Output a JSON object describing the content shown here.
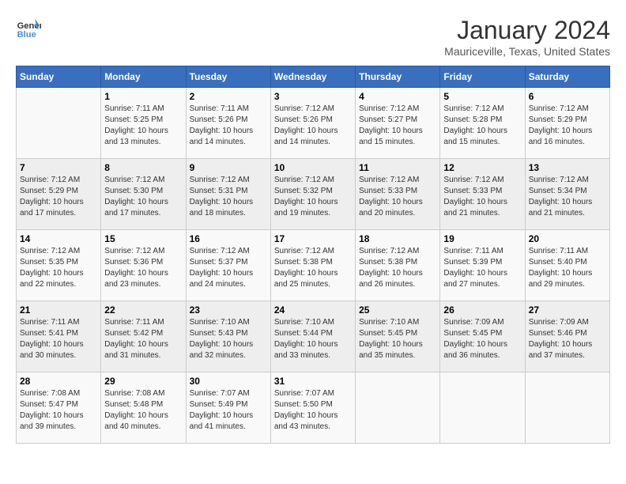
{
  "header": {
    "logo_line1": "General",
    "logo_line2": "Blue",
    "month": "January 2024",
    "location": "Mauriceville, Texas, United States"
  },
  "weekdays": [
    "Sunday",
    "Monday",
    "Tuesday",
    "Wednesday",
    "Thursday",
    "Friday",
    "Saturday"
  ],
  "weeks": [
    [
      {
        "day": "",
        "info": ""
      },
      {
        "day": "1",
        "info": "Sunrise: 7:11 AM\nSunset: 5:25 PM\nDaylight: 10 hours\nand 13 minutes."
      },
      {
        "day": "2",
        "info": "Sunrise: 7:11 AM\nSunset: 5:26 PM\nDaylight: 10 hours\nand 14 minutes."
      },
      {
        "day": "3",
        "info": "Sunrise: 7:12 AM\nSunset: 5:26 PM\nDaylight: 10 hours\nand 14 minutes."
      },
      {
        "day": "4",
        "info": "Sunrise: 7:12 AM\nSunset: 5:27 PM\nDaylight: 10 hours\nand 15 minutes."
      },
      {
        "day": "5",
        "info": "Sunrise: 7:12 AM\nSunset: 5:28 PM\nDaylight: 10 hours\nand 15 minutes."
      },
      {
        "day": "6",
        "info": "Sunrise: 7:12 AM\nSunset: 5:29 PM\nDaylight: 10 hours\nand 16 minutes."
      }
    ],
    [
      {
        "day": "7",
        "info": "Sunrise: 7:12 AM\nSunset: 5:29 PM\nDaylight: 10 hours\nand 17 minutes."
      },
      {
        "day": "8",
        "info": "Sunrise: 7:12 AM\nSunset: 5:30 PM\nDaylight: 10 hours\nand 17 minutes."
      },
      {
        "day": "9",
        "info": "Sunrise: 7:12 AM\nSunset: 5:31 PM\nDaylight: 10 hours\nand 18 minutes."
      },
      {
        "day": "10",
        "info": "Sunrise: 7:12 AM\nSunset: 5:32 PM\nDaylight: 10 hours\nand 19 minutes."
      },
      {
        "day": "11",
        "info": "Sunrise: 7:12 AM\nSunset: 5:33 PM\nDaylight: 10 hours\nand 20 minutes."
      },
      {
        "day": "12",
        "info": "Sunrise: 7:12 AM\nSunset: 5:33 PM\nDaylight: 10 hours\nand 21 minutes."
      },
      {
        "day": "13",
        "info": "Sunrise: 7:12 AM\nSunset: 5:34 PM\nDaylight: 10 hours\nand 21 minutes."
      }
    ],
    [
      {
        "day": "14",
        "info": "Sunrise: 7:12 AM\nSunset: 5:35 PM\nDaylight: 10 hours\nand 22 minutes."
      },
      {
        "day": "15",
        "info": "Sunrise: 7:12 AM\nSunset: 5:36 PM\nDaylight: 10 hours\nand 23 minutes."
      },
      {
        "day": "16",
        "info": "Sunrise: 7:12 AM\nSunset: 5:37 PM\nDaylight: 10 hours\nand 24 minutes."
      },
      {
        "day": "17",
        "info": "Sunrise: 7:12 AM\nSunset: 5:38 PM\nDaylight: 10 hours\nand 25 minutes."
      },
      {
        "day": "18",
        "info": "Sunrise: 7:12 AM\nSunset: 5:38 PM\nDaylight: 10 hours\nand 26 minutes."
      },
      {
        "day": "19",
        "info": "Sunrise: 7:11 AM\nSunset: 5:39 PM\nDaylight: 10 hours\nand 27 minutes."
      },
      {
        "day": "20",
        "info": "Sunrise: 7:11 AM\nSunset: 5:40 PM\nDaylight: 10 hours\nand 29 minutes."
      }
    ],
    [
      {
        "day": "21",
        "info": "Sunrise: 7:11 AM\nSunset: 5:41 PM\nDaylight: 10 hours\nand 30 minutes."
      },
      {
        "day": "22",
        "info": "Sunrise: 7:11 AM\nSunset: 5:42 PM\nDaylight: 10 hours\nand 31 minutes."
      },
      {
        "day": "23",
        "info": "Sunrise: 7:10 AM\nSunset: 5:43 PM\nDaylight: 10 hours\nand 32 minutes."
      },
      {
        "day": "24",
        "info": "Sunrise: 7:10 AM\nSunset: 5:44 PM\nDaylight: 10 hours\nand 33 minutes."
      },
      {
        "day": "25",
        "info": "Sunrise: 7:10 AM\nSunset: 5:45 PM\nDaylight: 10 hours\nand 35 minutes."
      },
      {
        "day": "26",
        "info": "Sunrise: 7:09 AM\nSunset: 5:45 PM\nDaylight: 10 hours\nand 36 minutes."
      },
      {
        "day": "27",
        "info": "Sunrise: 7:09 AM\nSunset: 5:46 PM\nDaylight: 10 hours\nand 37 minutes."
      }
    ],
    [
      {
        "day": "28",
        "info": "Sunrise: 7:08 AM\nSunset: 5:47 PM\nDaylight: 10 hours\nand 39 minutes."
      },
      {
        "day": "29",
        "info": "Sunrise: 7:08 AM\nSunset: 5:48 PM\nDaylight: 10 hours\nand 40 minutes."
      },
      {
        "day": "30",
        "info": "Sunrise: 7:07 AM\nSunset: 5:49 PM\nDaylight: 10 hours\nand 41 minutes."
      },
      {
        "day": "31",
        "info": "Sunrise: 7:07 AM\nSunset: 5:50 PM\nDaylight: 10 hours\nand 43 minutes."
      },
      {
        "day": "",
        "info": ""
      },
      {
        "day": "",
        "info": ""
      },
      {
        "day": "",
        "info": ""
      }
    ]
  ]
}
